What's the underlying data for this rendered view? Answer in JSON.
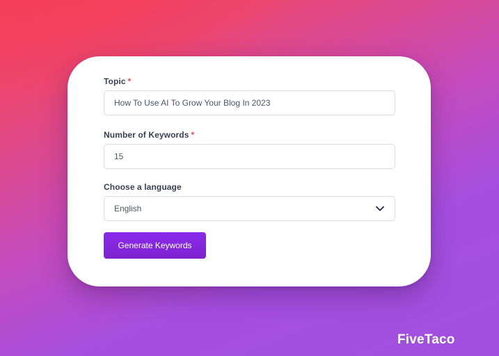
{
  "form": {
    "topic": {
      "label": "Topic",
      "required_mark": "*",
      "value": "How To Use AI To Grow Your Blog In 2023"
    },
    "keywords": {
      "label": "Number of Keywords",
      "required_mark": "*",
      "value": "15"
    },
    "language": {
      "label": "Choose a language",
      "selected": "English",
      "icon": "chevron-down-icon"
    },
    "submit_label": "Generate Keywords"
  },
  "brand": {
    "name": "FiveTaco"
  },
  "colors": {
    "accent": "#7e22ce",
    "required": "#ef4444",
    "background_top": "#f43f5e",
    "background_bottom": "#a050dc"
  }
}
